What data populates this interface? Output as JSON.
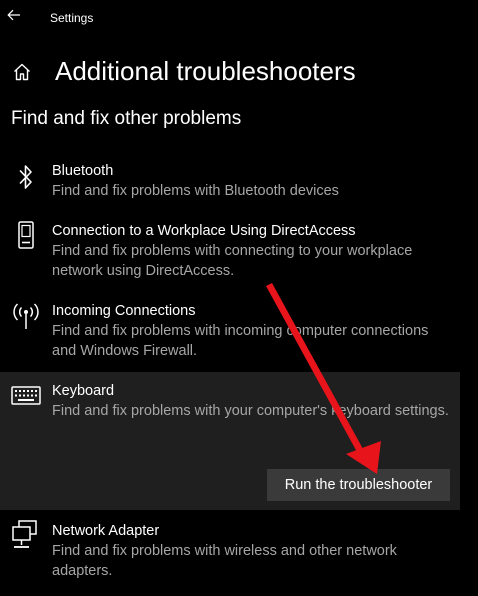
{
  "window": {
    "title": "Settings",
    "back_icon": "arrow-left-icon"
  },
  "header": {
    "home_icon": "home-icon",
    "title": "Additional troubleshooters"
  },
  "section": {
    "title": "Find and fix other problems"
  },
  "items": [
    {
      "icon": "bluetooth-icon",
      "name": "Bluetooth",
      "description": "Find and fix problems with Bluetooth devices"
    },
    {
      "icon": "phone-device-icon",
      "name": "Connection to a Workplace Using DirectAccess",
      "description": "Find and fix problems with connecting to your workplace network using DirectAccess."
    },
    {
      "icon": "antenna-icon",
      "name": "Incoming Connections",
      "description": "Find and fix problems with incoming computer connections and Windows Firewall."
    },
    {
      "icon": "keyboard-icon",
      "name": "Keyboard",
      "description": "Find and fix problems with your computer's keyboard settings.",
      "selected": true
    },
    {
      "icon": "network-adapter-icon",
      "name": "Network Adapter",
      "description": "Find and fix problems with wireless and other network adapters."
    }
  ],
  "run_button": {
    "label": "Run the troubleshooter"
  },
  "colors": {
    "background": "#000000",
    "selected_background": "#1f1f1f",
    "button_background": "#3a3a3a",
    "secondary_text": "#a6a6a6",
    "annotation_arrow": "#e8141b"
  }
}
